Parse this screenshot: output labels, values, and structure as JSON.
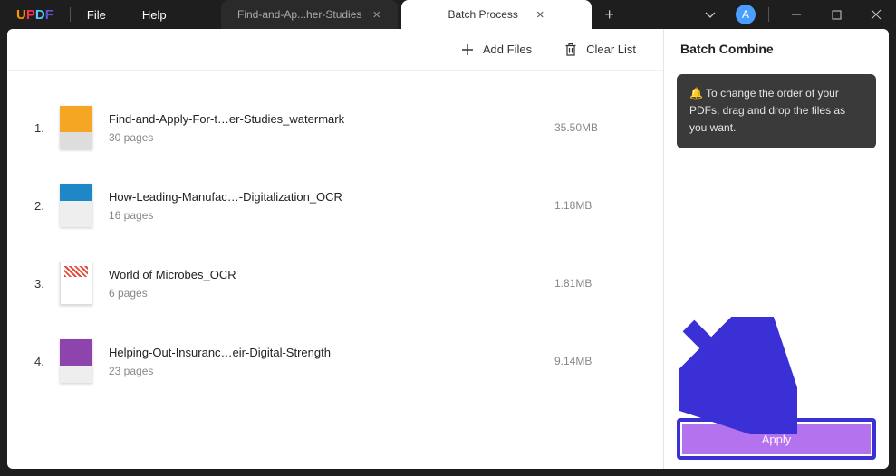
{
  "app": {
    "logo": {
      "u": "U",
      "p": "P",
      "d": "D",
      "f": "F"
    }
  },
  "menu": {
    "file": "File",
    "help": "Help"
  },
  "tabs": {
    "inactive_label": "Find-and-Ap...her-Studies",
    "active_label": "Batch Process"
  },
  "avatar": "A",
  "toolbar": {
    "add_files": "Add Files",
    "clear_list": "Clear List"
  },
  "files": [
    {
      "num": "1.",
      "name": "Find-and-Apply-For-t…er-Studies_watermark",
      "pages": "30 pages",
      "size": "35.50MB"
    },
    {
      "num": "2.",
      "name": "How-Leading-Manufac…-Digitalization_OCR",
      "pages": "16 pages",
      "size": "1.18MB"
    },
    {
      "num": "3.",
      "name": "World of Microbes_OCR",
      "pages": "6 pages",
      "size": "1.81MB"
    },
    {
      "num": "4.",
      "name": "Helping-Out-Insuranc…eir-Digital-Strength",
      "pages": "23 pages",
      "size": "9.14MB"
    }
  ],
  "side": {
    "title": "Batch Combine",
    "tip": "🔔  To change the order of your PDFs, drag and drop the files as you want.",
    "apply": "Apply"
  }
}
